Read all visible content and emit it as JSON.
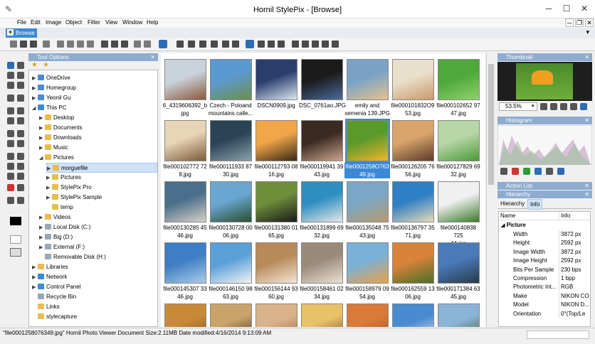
{
  "window": {
    "title": "Hornil StylePix - [Browse]",
    "minimize": "─",
    "maximize": "☐",
    "close": "✕"
  },
  "menu": [
    "File",
    "Edit",
    "Image",
    "Object",
    "Filter",
    "View",
    "Window",
    "Help"
  ],
  "tab": {
    "label": "Browse"
  },
  "tool_options": {
    "title": "Tool Options"
  },
  "tree": [
    {
      "label": "OneDrive",
      "indent": 0,
      "expander": "▶",
      "icon": "cloud"
    },
    {
      "label": "Homegroup",
      "indent": 0,
      "expander": "▶",
      "icon": "homegroup"
    },
    {
      "label": "Yeonil Gu",
      "indent": 0,
      "expander": "▶",
      "icon": "user"
    },
    {
      "label": "This PC",
      "indent": 0,
      "expander": "◢",
      "icon": "pc"
    },
    {
      "label": "Desktop",
      "indent": 1,
      "expander": "▶",
      "icon": "folder"
    },
    {
      "label": "Documents",
      "indent": 1,
      "expander": "▶",
      "icon": "folder"
    },
    {
      "label": "Downloads",
      "indent": 1,
      "expander": "▶",
      "icon": "folder"
    },
    {
      "label": "Music",
      "indent": 1,
      "expander": "▶",
      "icon": "folder"
    },
    {
      "label": "Pictures",
      "indent": 1,
      "expander": "◢",
      "icon": "folder"
    },
    {
      "label": "morguefile",
      "indent": 2,
      "expander": "▶",
      "icon": "folder",
      "selected": true
    },
    {
      "label": "Pictures",
      "indent": 2,
      "expander": "▶",
      "icon": "folder"
    },
    {
      "label": "StylePix Pro",
      "indent": 2,
      "expander": "▶",
      "icon": "folder"
    },
    {
      "label": "StylePix Sample",
      "indent": 2,
      "expander": "▶",
      "icon": "folder"
    },
    {
      "label": "temp",
      "indent": 2,
      "expander": "",
      "icon": "folder"
    },
    {
      "label": "Videos",
      "indent": 1,
      "expander": "▶",
      "icon": "folder"
    },
    {
      "label": "Local Disk (C:)",
      "indent": 1,
      "expander": "▶",
      "icon": "disk"
    },
    {
      "label": "Big (D:)",
      "indent": 1,
      "expander": "▶",
      "icon": "disk"
    },
    {
      "label": "External (F:)",
      "indent": 1,
      "expander": "▶",
      "icon": "disk"
    },
    {
      "label": "Removable Disk (H:)",
      "indent": 1,
      "expander": "",
      "icon": "disk"
    },
    {
      "label": "Libraries",
      "indent": 0,
      "expander": "▶",
      "icon": "folder"
    },
    {
      "label": "Network",
      "indent": 0,
      "expander": "▶",
      "icon": "pc"
    },
    {
      "label": "Control Panel",
      "indent": 0,
      "expander": "▶",
      "icon": "pc"
    },
    {
      "label": "Recycle Bin",
      "indent": 0,
      "expander": "",
      "icon": "disk"
    },
    {
      "label": "Links",
      "indent": 0,
      "expander": "",
      "icon": "folder"
    },
    {
      "label": "stylecapture",
      "indent": 0,
      "expander": "",
      "icon": "folder"
    }
  ],
  "images": [
    {
      "caption": "6_4319606392_b\njpg",
      "colors": [
        "#c9d3dc",
        "#8a5a3a"
      ]
    },
    {
      "caption": "Czech - Poloand\nmountains calle...",
      "colors": [
        "#5b9ad0",
        "#6d8f4a"
      ]
    },
    {
      "caption": "DSCN0909.jpg",
      "colors": [
        "#2a3e6e",
        "#d9e6f0"
      ]
    },
    {
      "caption": "DSC_0761ao.JPG",
      "colors": [
        "#1b1b1b",
        "#4a6b9a"
      ]
    },
    {
      "caption": "emily and\nxemenia 139.JPG",
      "colors": [
        "#7aa2c7",
        "#e6c28d"
      ]
    },
    {
      "caption": "file000101832O9\n53.jpg",
      "colors": [
        "#e9e0cc",
        "#c79a6a"
      ]
    },
    {
      "caption": "file000102652 97\n47.jpg",
      "colors": [
        "#4ea83a",
        "#8fd16a"
      ]
    },
    {
      "caption": "file000102772 72\n8.jpg",
      "colors": [
        "#e8d4b6",
        "#7b5b3c"
      ]
    },
    {
      "caption": "file000111933 87\n30.jpg",
      "colors": [
        "#2a4355",
        "#8aa1ad"
      ]
    },
    {
      "caption": "file000112793 08\n16.jpg",
      "colors": [
        "#f1a64a",
        "#3a2a14"
      ]
    },
    {
      "caption": "file000119941 39\n43.jpg",
      "colors": [
        "#3b2a22",
        "#caa58d"
      ]
    },
    {
      "caption": "file0001258O763\n49.jpg",
      "colors": [
        "#5a9a2c",
        "#f0b42a"
      ]
    },
    {
      "caption": "file000126205 76\n56.jpg",
      "colors": [
        "#d9a56a",
        "#5a3a2a"
      ]
    },
    {
      "caption": "file000127829 69\n32.jpg",
      "colors": [
        "#b7d7a8",
        "#4c9a3a"
      ]
    },
    {
      "caption": "file000130285 45\n46.jpg",
      "colors": [
        "#4a6f8a",
        "#d6d0c4"
      ]
    },
    {
      "caption": "file000130728 00\n06.jpg",
      "colors": [
        "#6aa6cf",
        "#2a4e2e"
      ]
    },
    {
      "caption": "file000131380 01\n65.jpg",
      "colors": [
        "#6e8f3a",
        "#1a1a1a"
      ]
    },
    {
      "caption": "file000131899 69\n32.jpg",
      "colors": [
        "#2f8fc2",
        "#e6e6e6"
      ]
    },
    {
      "caption": "file000135048 75\n43.jpg",
      "colors": [
        "#7aa7c7",
        "#b89a6a"
      ]
    },
    {
      "caption": "file000136797 35\n71.jpg",
      "colors": [
        "#2e7fc4",
        "#e6d9b8"
      ]
    },
    {
      "caption": "file000140838 725\n44.jpg",
      "colors": [
        "#f0f0f0",
        "#3a7a2a"
      ]
    },
    {
      "caption": "file000145307 33\n46.jpg",
      "colors": [
        "#3d7ec4",
        "#aacbe6"
      ]
    },
    {
      "caption": "file000146150 98\n63.jpg",
      "colors": [
        "#5a9fd8",
        "#f2f2f2"
      ]
    },
    {
      "caption": "file000156144 93\n60.jpg",
      "colors": [
        "#b88a5a",
        "#f2e6d6"
      ]
    },
    {
      "caption": "file000158461 02\n34.jpg",
      "colors": [
        "#9a8a7a",
        "#e9e0d4"
      ]
    },
    {
      "caption": "file000158979 09\n54.jpg",
      "colors": [
        "#7ab0d8",
        "#e8a24a"
      ]
    },
    {
      "caption": "file000162559 13\n06.jpg",
      "colors": [
        "#d9823a",
        "#4a6e2a"
      ]
    },
    {
      "caption": "file000171384 63\n45.jpg",
      "colors": [
        "#4a7ab8",
        "#2a3a4a"
      ]
    },
    {
      "caption": "",
      "colors": [
        "#c88a3a",
        "#7a4a1a"
      ]
    },
    {
      "caption": "",
      "colors": [
        "#c9a36a",
        "#3a2a1a"
      ]
    },
    {
      "caption": "",
      "colors": [
        "#d9b38a",
        "#a05a3a"
      ]
    },
    {
      "caption": "",
      "colors": [
        "#e8c26a",
        "#6a4a2a"
      ]
    },
    {
      "caption": "",
      "colors": [
        "#d97a3a",
        "#a04a1a"
      ]
    },
    {
      "caption": "",
      "colors": [
        "#4a8ad0",
        "#e6e6e6"
      ]
    },
    {
      "caption": "",
      "colors": [
        "#8ab3d8",
        "#3a5a2a"
      ]
    }
  ],
  "thumbnail": {
    "title": "Thumbnail",
    "zoom": "53.5%"
  },
  "histogram": {
    "title": "Histogram"
  },
  "action_list": {
    "title": "Action List"
  },
  "hierarchy": {
    "title": "Hierarchy",
    "tabs": [
      "Hierarchy",
      "Info"
    ],
    "col_name": "Name",
    "col_info": "Info",
    "group": "Picture"
  },
  "properties": [
    {
      "k": "Width",
      "v": "3872 px"
    },
    {
      "k": "Height",
      "v": "2592 px"
    },
    {
      "k": "Image Width",
      "v": "3872 px"
    },
    {
      "k": "Image Height",
      "v": "2592 px"
    },
    {
      "k": "Bits Per Sample",
      "v": "230 bps"
    },
    {
      "k": "Compression",
      "v": "1 bpp"
    },
    {
      "k": "Photometric Int...",
      "v": "RGB"
    },
    {
      "k": "Make",
      "v": "NIKON CO"
    },
    {
      "k": "Model",
      "v": "NIKON D..."
    },
    {
      "k": "Orientation",
      "v": "0°(Top/Le"
    }
  ],
  "status": "\"file0001258076349.jpg\" Hornil Photo Viewer Document Size:2.11MB Date modified:4/16/2014 9:13:09 AM"
}
